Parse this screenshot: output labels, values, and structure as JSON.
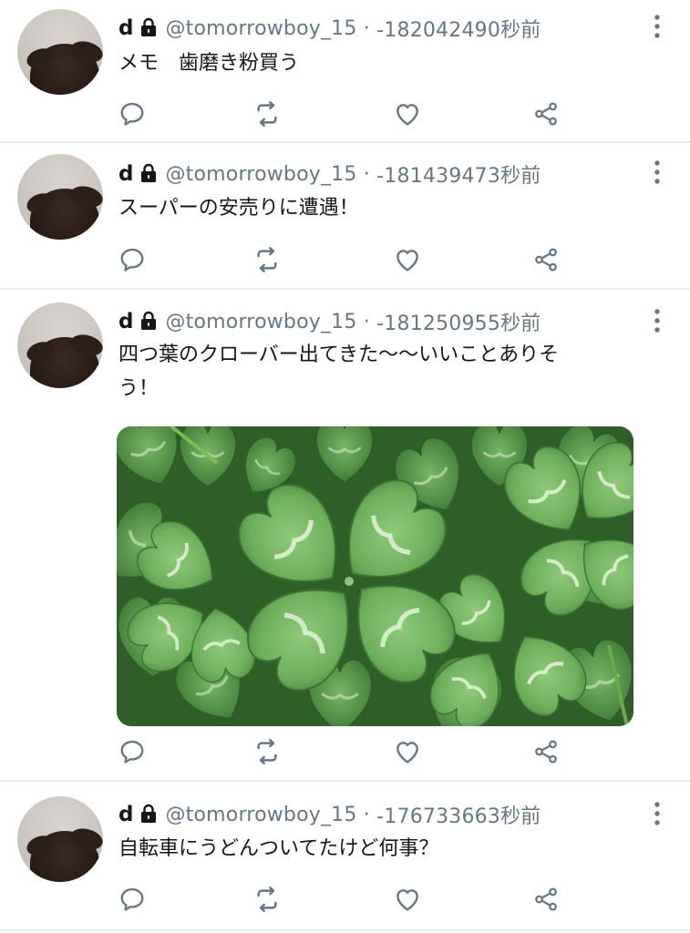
{
  "tweets": [
    {
      "name": "d",
      "handle": "@tomorrowboy_15",
      "separator": " · ",
      "time": "-182042490秒前",
      "text": "メモ　歯磨き粉買う"
    },
    {
      "name": "d",
      "handle": "@tomorrowboy_15",
      "separator": " · ",
      "time": "-181439473秒前",
      "text": "スーパーの安売りに遭遇！"
    },
    {
      "name": "d",
      "handle": "@tomorrowboy_15",
      "separator": " · ",
      "time": "-181250955秒前",
      "text_line1": "四つ葉のクローバー出てきた〜〜いいことありそ",
      "text_line2": "う！",
      "media": "four-leaf-clover-photo"
    },
    {
      "name": "d",
      "handle": "@tomorrowboy_15",
      "separator": " · ",
      "time": "-176733663秒前",
      "text": "自転車にうどんついてたけど何事？"
    }
  ],
  "icons": {
    "reply": "reply-icon",
    "retweet": "retweet-icon",
    "like": "like-icon",
    "share": "share-icon",
    "more": "more-vertical-icon",
    "lock": "lock-icon"
  },
  "colors": {
    "text": "#14171a",
    "secondary": "#657786",
    "icon": "#657786",
    "divider": "#e6ecf0"
  }
}
